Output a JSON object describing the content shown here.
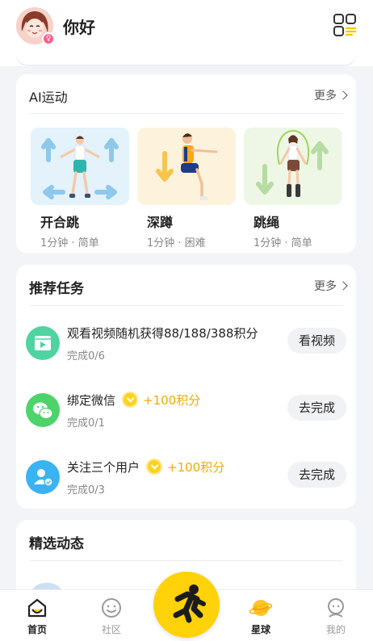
{
  "header": {
    "greeting": "你好",
    "gender_symbol": "♀"
  },
  "ai_sports": {
    "title": "AI运动",
    "more_label": "更多",
    "items": [
      {
        "name": "开合跳",
        "meta": "1分钟 · 简单"
      },
      {
        "name": "深蹲",
        "meta": "1分钟 · 困难"
      },
      {
        "name": "跳绳",
        "meta": "1分钟 · 简单"
      }
    ]
  },
  "tasks": {
    "title": "推荐任务",
    "more_label": "更多",
    "items": [
      {
        "title": "观看视频随机获得88/188/388积分",
        "reward": "",
        "progress": "完成0/6",
        "button": "看视频",
        "icon": "video-icon",
        "color": "#4fd3a1"
      },
      {
        "title": "绑定微信",
        "reward": "+100积分",
        "progress": "完成0/1",
        "button": "去完成",
        "icon": "wechat-icon",
        "color": "#4cd46a"
      },
      {
        "title": "关注三个用户",
        "reward": "+100积分",
        "progress": "完成0/3",
        "button": "去完成",
        "icon": "user-follow-icon",
        "color": "#3ab3f3"
      }
    ]
  },
  "feed": {
    "title": "精选动态"
  },
  "tabbar": {
    "items": [
      {
        "label": "首页",
        "icon": "home-icon",
        "active": true
      },
      {
        "label": "社区",
        "icon": "community-icon",
        "active": false
      },
      {
        "label": "星球",
        "icon": "planet-icon",
        "active": false
      },
      {
        "label": "我的",
        "icon": "profile-icon",
        "active": false
      }
    ],
    "center_icon": "running-man-icon"
  },
  "colors": {
    "accent": "#ffd20a",
    "reward": "#f5a900"
  }
}
